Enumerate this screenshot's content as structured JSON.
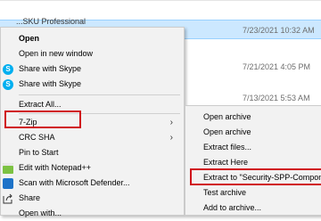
{
  "file_list": {
    "rows": [
      {
        "name": "...SKU Professional",
        "date": "7/23/2021 10:32 AM"
      },
      {
        "date": "7/21/2021 4:05 PM"
      },
      {
        "date": "7/13/2021 5:53 AM"
      }
    ]
  },
  "context_menu": {
    "items": [
      {
        "label": "Open"
      },
      {
        "label": "Open in new window"
      },
      {
        "label": "Share with Skype"
      },
      {
        "label": "Share with Skype"
      },
      {
        "label": "Extract All..."
      },
      {
        "label": "7-Zip"
      },
      {
        "label": "CRC SHA"
      },
      {
        "label": "Pin to Start"
      },
      {
        "label": "Edit with Notepad++"
      },
      {
        "label": "Scan with Microsoft Defender..."
      },
      {
        "label": "Share"
      },
      {
        "label": "Open with..."
      }
    ]
  },
  "submenu": {
    "items": [
      {
        "label": "Open archive"
      },
      {
        "label": "Open archive"
      },
      {
        "label": "Extract files..."
      },
      {
        "label": "Extract Here"
      },
      {
        "label": "Extract to \"Security-SPP-Compon"
      },
      {
        "label": "Test archive"
      },
      {
        "label": "Add to archive..."
      }
    ]
  },
  "colors": {
    "selection": "#cce8ff",
    "highlight_box": "#d0121b",
    "menu_bg": "#f2f2f2"
  }
}
